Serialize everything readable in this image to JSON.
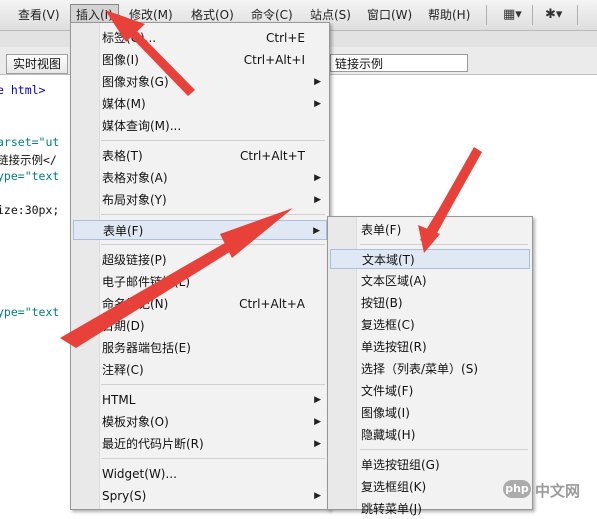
{
  "menubar": {
    "items": [
      "查看(V)",
      "插入(I)",
      "修改(M)",
      "格式(O)",
      "命令(C)",
      "站点(S)",
      "窗口(W)",
      "帮助(H)"
    ],
    "active": "插入(I)"
  },
  "toolbar": {
    "live_view_label": "实时视图",
    "title_field_value": "链接示例"
  },
  "code_fragments": [
    "e html>",
    "arset=\"ut",
    "链接示例</",
    "ype=\"text",
    "ize:30px;",
    "ype=\"text"
  ],
  "insert_menu": {
    "items": [
      {
        "label": "标签(G)...",
        "shortcut": "Ctrl+E",
        "submenu": false
      },
      {
        "label": "图像(I)",
        "shortcut": "Ctrl+Alt+I",
        "submenu": false
      },
      {
        "label": "图像对象(G)",
        "shortcut": "",
        "submenu": true
      },
      {
        "label": "媒体(M)",
        "shortcut": "",
        "submenu": true
      },
      {
        "label": "媒体查询(M)...",
        "shortcut": "",
        "submenu": false
      },
      {
        "label": "表格(T)",
        "shortcut": "Ctrl+Alt+T",
        "submenu": false
      },
      {
        "label": "表格对象(A)",
        "shortcut": "",
        "submenu": true
      },
      {
        "label": "布局对象(Y)",
        "shortcut": "",
        "submenu": true
      },
      {
        "label": "表单(F)",
        "shortcut": "",
        "submenu": true,
        "highlighted": true
      },
      {
        "label": "超级链接(P)",
        "shortcut": "",
        "submenu": false
      },
      {
        "label": "电子邮件链接(L)",
        "shortcut": "",
        "submenu": false
      },
      {
        "label": "命名锚记(N)",
        "shortcut": "Ctrl+Alt+A",
        "submenu": false
      },
      {
        "label": "日期(D)",
        "shortcut": "",
        "submenu": false
      },
      {
        "label": "服务器端包括(E)",
        "shortcut": "",
        "submenu": false
      },
      {
        "label": "注释(C)",
        "shortcut": "",
        "submenu": false
      },
      {
        "label": "HTML",
        "shortcut": "",
        "submenu": true
      },
      {
        "label": "模板对象(O)",
        "shortcut": "",
        "submenu": true
      },
      {
        "label": "最近的代码片断(R)",
        "shortcut": "",
        "submenu": true
      },
      {
        "label": "Widget(W)...",
        "shortcut": "",
        "submenu": false
      },
      {
        "label": "Spry(S)",
        "shortcut": "",
        "submenu": true
      }
    ]
  },
  "form_submenu": {
    "items": [
      {
        "label": "表单(F)"
      },
      {
        "label": "文本域(T)",
        "highlighted": true
      },
      {
        "label": "文本区域(A)"
      },
      {
        "label": "按钮(B)"
      },
      {
        "label": "复选框(C)"
      },
      {
        "label": "单选按钮(R)"
      },
      {
        "label": "选择（列表/菜单）(S)"
      },
      {
        "label": "文件域(F)"
      },
      {
        "label": "图像域(I)"
      },
      {
        "label": "隐藏域(H)"
      },
      {
        "label": "单选按钮组(G)"
      },
      {
        "label": "复选框组(K)"
      },
      {
        "label": "跳转菜单(J)"
      }
    ]
  },
  "annotation_color": "#e8413a",
  "watermark": {
    "logo": "php",
    "text": "中文网"
  }
}
